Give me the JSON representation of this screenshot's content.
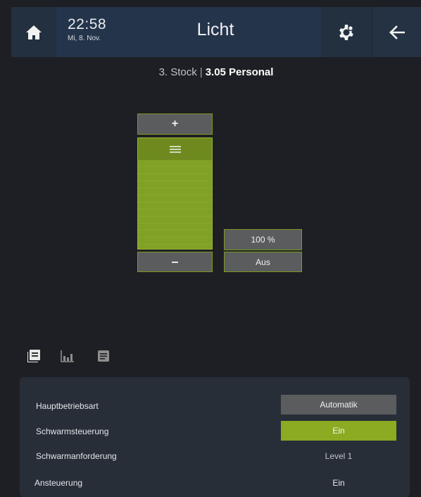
{
  "header": {
    "time": "22:58",
    "date": "Mi, 8. Nov.",
    "title": "Licht",
    "icons": {
      "home": "home-icon",
      "settings": "settings-gear-icon",
      "back": "arrow-left-icon"
    }
  },
  "location": {
    "floor": "3. Stock",
    "separator": "|",
    "room": "3.05 Personal"
  },
  "dimmer": {
    "plus_label": "+",
    "minus_label": "–",
    "level_label": "100 %",
    "level_fraction": 1.0,
    "off_label": "Aus"
  },
  "tabs": [
    {
      "name": "overview-tab",
      "icon": "list-card-icon"
    },
    {
      "name": "chart-tab",
      "icon": "bar-chart-icon"
    },
    {
      "name": "notes-tab",
      "icon": "document-icon"
    }
  ],
  "panel": {
    "rows": [
      {
        "label": "Hauptbetriebsart",
        "value": "Automatik"
      },
      {
        "label": "Schwarmsteuerung",
        "value": "Ein"
      },
      {
        "label": "Schwarmanforderung",
        "value": "Level 1"
      },
      {
        "label": "Ansteuerung",
        "value": "Ein"
      }
    ]
  },
  "colors": {
    "accent": "#8aab22",
    "header_bg": "#24344a",
    "background": "#1e1f24",
    "panel_bg": "#282e38"
  }
}
